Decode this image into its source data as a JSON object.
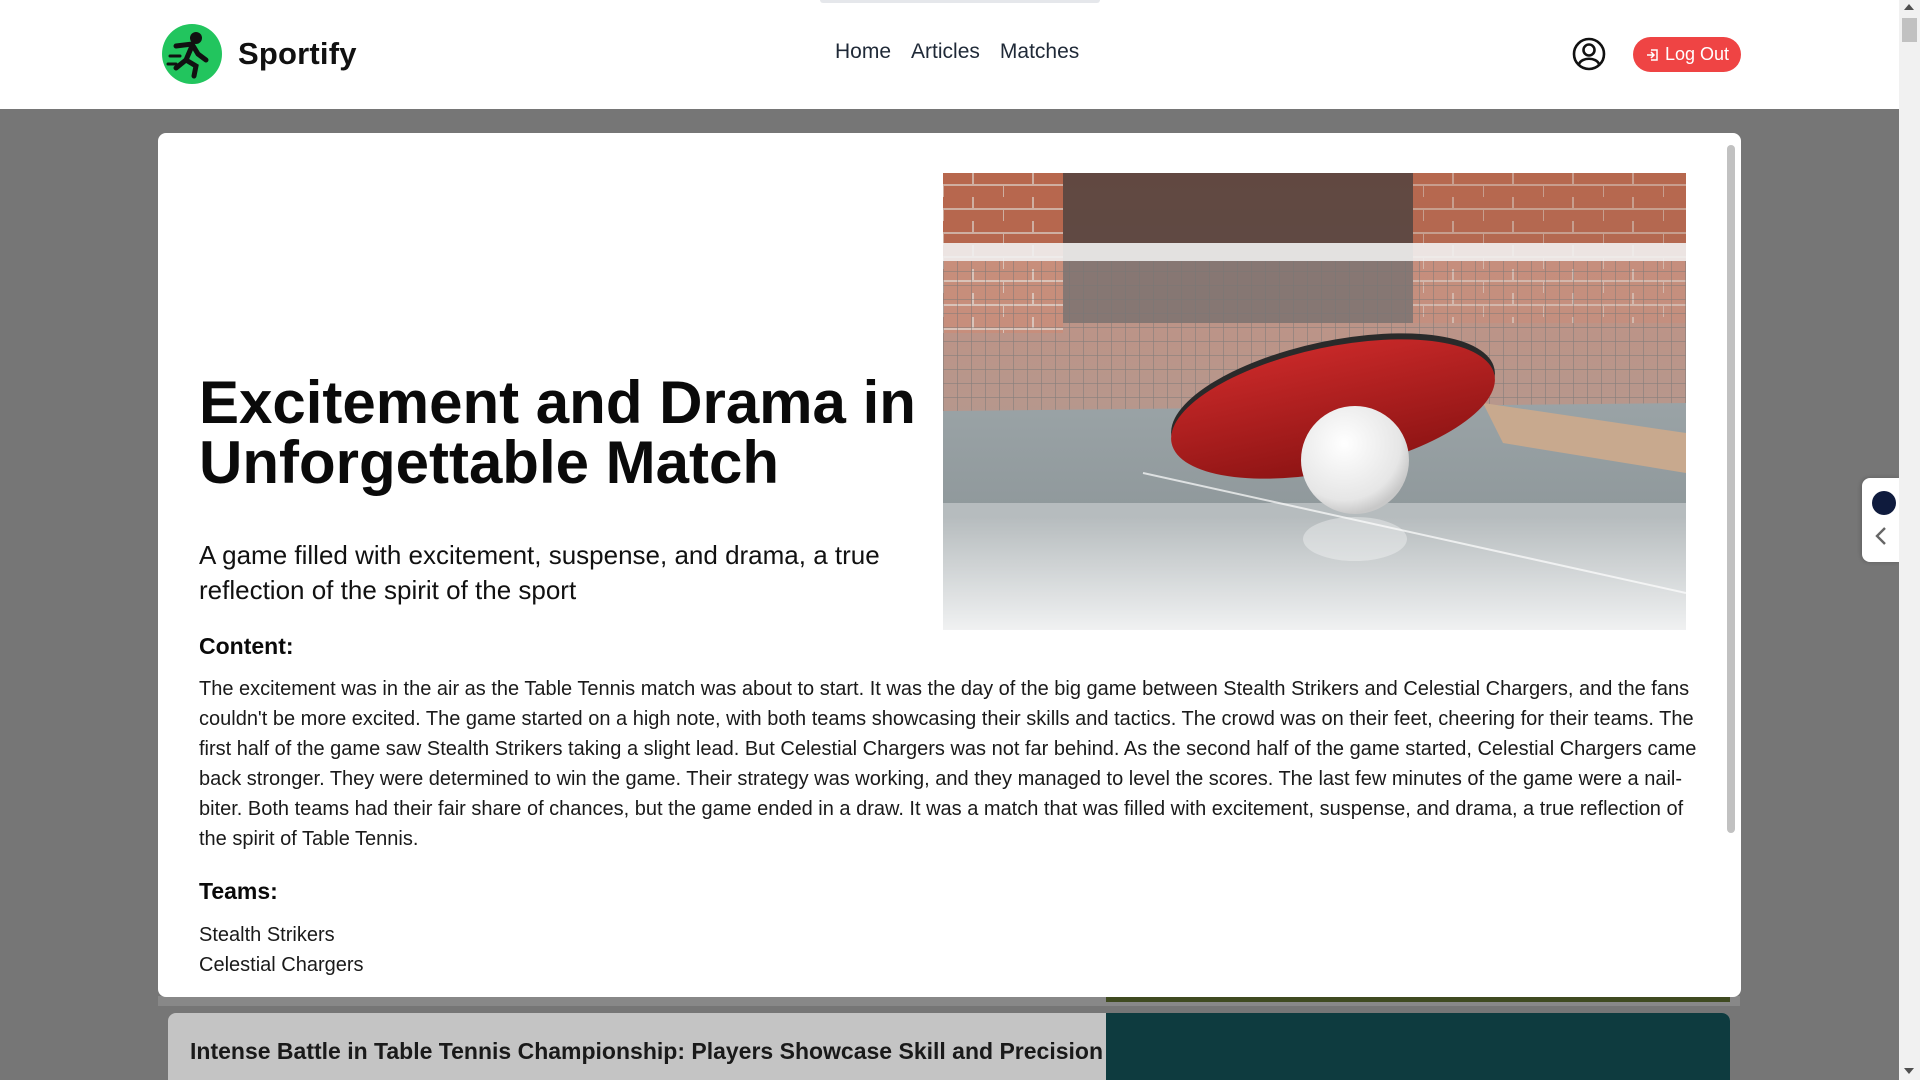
{
  "brand": {
    "name": "Sportify",
    "accent": "#22c55e"
  },
  "nav": {
    "items": [
      "Home",
      "Articles",
      "Matches"
    ]
  },
  "header": {
    "logout_label": "Log Out",
    "logout_color": "#ef4444",
    "user_icon": "user-circle-icon"
  },
  "modal": {
    "title": "Excitement and Drama in Unforgettable Match",
    "subtitle": "A game filled with excitement, suspense, and drama, a true reflection of the spirit of the sport",
    "content_label": "Content:",
    "content": "The excitement was in the air as the Table Tennis match was about to start. It was the day of the big game between Stealth Strikers and Celestial Chargers, and the fans couldn't be more excited. The game started on a high note, with both teams showcasing their skills and tactics. The crowd was on their feet, cheering for their teams. The first half of the game saw Stealth Strikers taking a slight lead. But Celestial Chargers was not far behind. As the second half of the game started, Celestial Chargers came back stronger. They were determined to win the game. Their strategy was working, and they managed to level the scores. The last few minutes of the game were a nail-biter. Both teams had their fair share of chances, but the game ended in a draw. It was a match that was filled with excitement, suspense, and drama, a true reflection of the spirit of Table Tennis.",
    "teams_label": "Teams:",
    "teams": [
      "Stealth Strikers",
      "Celestial Chargers"
    ],
    "image_icon": "table-tennis-paddle-image"
  },
  "background_list": {
    "card_title": "Intense Battle in Table Tennis Championship: Players Showcase Skill and Precision"
  }
}
